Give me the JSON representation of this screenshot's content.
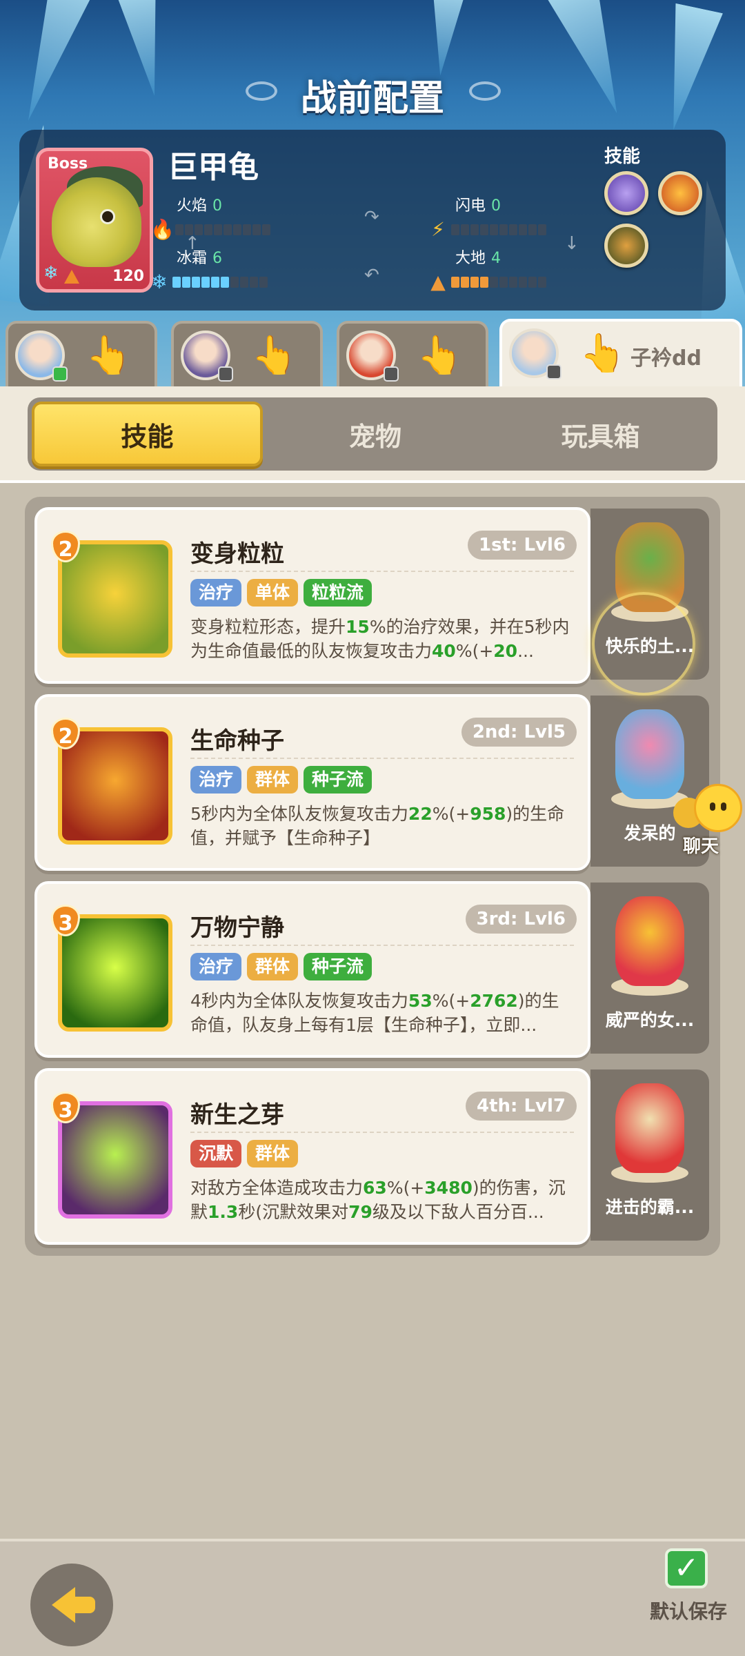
{
  "title": "战前配置",
  "boss": {
    "tag": "Boss",
    "name": "巨甲龟",
    "level": "120",
    "skills_label": "技能",
    "stats": [
      {
        "label": "火焰",
        "value": "0",
        "filled": 0,
        "color": "#f0504a"
      },
      {
        "label": "闪电",
        "value": "0",
        "filled": 0,
        "color": "#f7c235"
      },
      {
        "label": "冰霜",
        "value": "6",
        "filled": 6,
        "color": "#6ad0ff"
      },
      {
        "label": "大地",
        "value": "4",
        "filled": 4,
        "color": "#f09a3a"
      }
    ],
    "skill_icons": [
      "lightning-swirl-icon",
      "fire-crown-icon",
      "shadow-beast-icon"
    ]
  },
  "hero_tabs": [
    {
      "avatar": "hero-avatar-blue-hair",
      "badge": "green",
      "hand_icon": "tap-hand-icon",
      "name": ""
    },
    {
      "avatar": "hero-avatar-purple-hair",
      "badge": "gray",
      "hand_icon": "tap-hand-icon",
      "name": ""
    },
    {
      "avatar": "hero-avatar-red-hair",
      "badge": "gray",
      "hand_icon": "tap-hand-icon",
      "name": ""
    },
    {
      "avatar": "hero-avatar-blue-hair",
      "badge": "gray",
      "hand_icon": "tap-hand-icon",
      "name": "子衿dd"
    }
  ],
  "segments": {
    "skill": "技能",
    "pet": "宠物",
    "toybox": "玩具箱",
    "active": "skill"
  },
  "skills": [
    {
      "rank": "2",
      "name": "变身粒粒",
      "level": "1st: Lvl6",
      "tags": [
        {
          "text": "治疗",
          "color": "blue"
        },
        {
          "text": "单体",
          "color": "orange"
        },
        {
          "text": "粒粒流",
          "color": "green"
        }
      ],
      "desc": [
        {
          "t": "变身粒粒形态，提升"
        },
        {
          "t": "15",
          "hl": true
        },
        {
          "t": "%的治疗效果，并在5秒内为生命值最低的队友恢复攻击力"
        },
        {
          "t": "40",
          "hl": true
        },
        {
          "t": "%(+"
        },
        {
          "t": "20",
          "hl": true
        },
        {
          "t": "..."
        }
      ],
      "icon_colors": [
        "#f7d23a",
        "#7a9e2a"
      ],
      "pet_name": "快乐的土...",
      "pet_colors": [
        "#d08838",
        "#6ab04a"
      ]
    },
    {
      "rank": "2",
      "name": "生命种子",
      "level": "2nd: Lvl5",
      "tags": [
        {
          "text": "治疗",
          "color": "blue"
        },
        {
          "text": "群体",
          "color": "orange"
        },
        {
          "text": "种子流",
          "color": "green"
        }
      ],
      "desc": [
        {
          "t": "5秒内为全体队友恢复攻击力"
        },
        {
          "t": "22",
          "hl": true
        },
        {
          "t": "%(+"
        },
        {
          "t": "958",
          "hl": true
        },
        {
          "t": ")的生命值，并赋予【生命种子】"
        }
      ],
      "icon_colors": [
        "#f7a830",
        "#a02818"
      ],
      "pet_name": "发呆的",
      "pet_colors": [
        "#68aede",
        "#f08ab0"
      ]
    },
    {
      "rank": "3",
      "name": "万物宁静",
      "level": "3rd: Lvl6",
      "tags": [
        {
          "text": "治疗",
          "color": "blue"
        },
        {
          "text": "群体",
          "color": "orange"
        },
        {
          "text": "种子流",
          "color": "green"
        }
      ],
      "desc": [
        {
          "t": "4秒内为全体队友恢复攻击力"
        },
        {
          "t": "53",
          "hl": true
        },
        {
          "t": "%(+"
        },
        {
          "t": "2762",
          "hl": true
        },
        {
          "t": ")的生命值，队友身上每有1层【生命种子】，立即..."
        }
      ],
      "icon_colors": [
        "#d8ff48",
        "#2a6a10"
      ],
      "pet_name": "威严的女...",
      "pet_colors": [
        "#e03848",
        "#f7c235"
      ]
    },
    {
      "rank": "3",
      "name": "新生之芽",
      "level": "4th: Lvl7",
      "tags": [
        {
          "text": "沉默",
          "color": "red"
        },
        {
          "text": "群体",
          "color": "orange"
        }
      ],
      "desc": [
        {
          "t": "对敌方全体造成攻击力"
        },
        {
          "t": "63",
          "hl": true
        },
        {
          "t": "%(+"
        },
        {
          "t": "3480",
          "hl": true
        },
        {
          "t": ")的伤害，沉默"
        },
        {
          "t": "1.3",
          "hl": true
        },
        {
          "t": "秒(沉默效果对"
        },
        {
          "t": "79",
          "hl": true
        },
        {
          "t": "级及以下敌人百分百..."
        }
      ],
      "icon_colors": [
        "#b8f050",
        "#5a2a6a"
      ],
      "icon_border": "#e070e0",
      "pet_name": "进击的霸...",
      "pet_colors": [
        "#e03838",
        "#f0e0b0"
      ]
    }
  ],
  "chat_label": "聊天",
  "footer": {
    "back_icon": "back-arrow-icon",
    "save_label": "默认保存",
    "save_icon": "checkmark-icon"
  },
  "colors": {
    "accent_yellow": "#f7c235",
    "highlight_green": "#2aa02a",
    "bg_tan": "#c8c0b0"
  }
}
